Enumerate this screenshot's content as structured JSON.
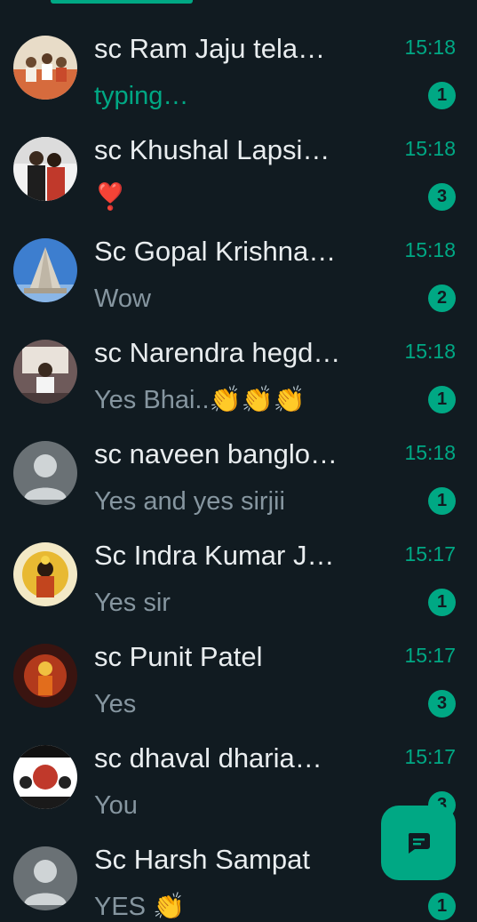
{
  "colors": {
    "background": "#111b21",
    "accent": "#00a884",
    "name": "#e9edef",
    "preview": "#8696a0"
  },
  "chats": [
    {
      "name": "sc Ram Jaju tela…",
      "time": "15:18",
      "preview": "typing…",
      "unread": "1"
    },
    {
      "name": "sc Khushal Lapsi…",
      "time": "15:18",
      "preview": "❣️",
      "unread": "3"
    },
    {
      "name": "Sc Gopal Krishna…",
      "time": "15:18",
      "preview": "Wow",
      "unread": "2"
    },
    {
      "name": "sc Narendra hegd…",
      "time": "15:18",
      "preview": "Yes Bhai..👏👏👏",
      "unread": "1"
    },
    {
      "name": "sc naveen banglo…",
      "time": "15:18",
      "preview": "Yes and yes sirjii",
      "unread": "1"
    },
    {
      "name": "Sc Indra Kumar J…",
      "time": "15:17",
      "preview": "Yes sir",
      "unread": "1"
    },
    {
      "name": "sc Punit Patel",
      "time": "15:17",
      "preview": "Yes",
      "unread": "3"
    },
    {
      "name": "sc dhaval dharia…",
      "time": "15:17",
      "preview": "You",
      "unread": "3"
    },
    {
      "name": "Sc Harsh Sampat",
      "time": "",
      "preview": "YES 👏",
      "unread": "1"
    }
  ],
  "fab": {
    "icon": "new-chat-icon"
  }
}
